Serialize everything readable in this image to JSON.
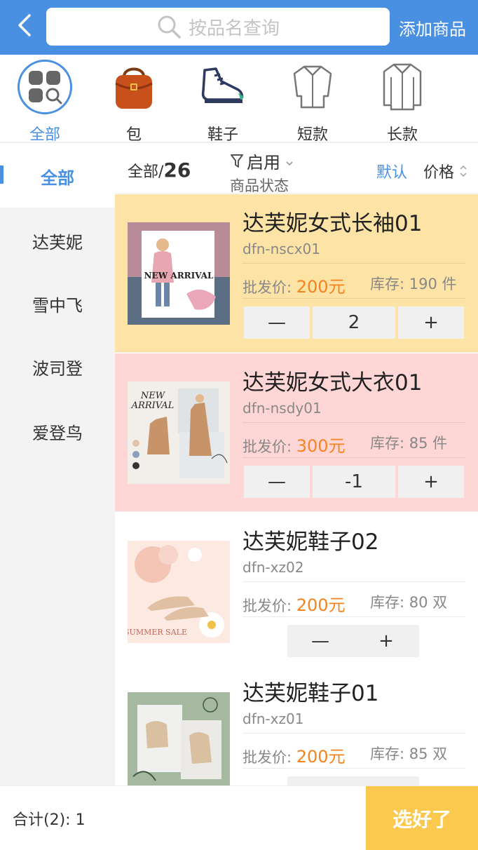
{
  "header": {
    "search_placeholder": "按品名查询",
    "add_label": "添加商品"
  },
  "categories": [
    {
      "label": "全部",
      "icon": "grid-search-icon",
      "active": true
    },
    {
      "label": "包",
      "icon": "bag-icon"
    },
    {
      "label": "鞋子",
      "icon": "shoe-icon"
    },
    {
      "label": "短款",
      "icon": "short-shirt-icon"
    },
    {
      "label": "长款",
      "icon": "long-shirt-icon"
    }
  ],
  "sidebar": {
    "items": [
      {
        "label": "全部",
        "active": true
      },
      {
        "label": "达芙妮"
      },
      {
        "label": "雪中飞"
      },
      {
        "label": "波司登"
      },
      {
        "label": "爱登鸟"
      }
    ]
  },
  "filter": {
    "count_prefix": "全部/",
    "count": "26",
    "status_value": "启用",
    "status_label": "商品状态",
    "sort_default": "默认",
    "sort_price": "价格"
  },
  "products": [
    {
      "name": "达芙妮女式长袖01",
      "code": "dfn-nscx01",
      "price_label": "批发价:",
      "price": "200元",
      "stock": "库存: 190 件",
      "qty": "2",
      "bg": "#fde3a6"
    },
    {
      "name": "达芙妮女式大衣01",
      "code": "dfn-nsdy01",
      "price_label": "批发价:",
      "price": "300元",
      "stock": "库存: 85 件",
      "qty": "-1",
      "bg": "#ffd6d6"
    },
    {
      "name": "达芙妮鞋子02",
      "code": "dfn-xz02",
      "price_label": "批发价:",
      "price": "200元",
      "stock": "库存: 80 双",
      "qty": "",
      "bg": "#ffffff"
    },
    {
      "name": "达芙妮鞋子01",
      "code": "dfn-xz01",
      "price_label": "批发价:",
      "price": "200元",
      "stock": "库存: 85 双",
      "qty": "",
      "bg": "#ffffff"
    }
  ],
  "stepper": {
    "minus": "—",
    "plus": "+"
  },
  "thumb_text": {
    "new_arrival": "NEW ARRIVAL",
    "new": "NEW",
    "arrival": "ARRIVAL",
    "summer_sale": "SUMMER SALE"
  },
  "footer": {
    "total": "合计(2): 1",
    "done_label": "选好了"
  },
  "colors": {
    "primary": "#4a90e2",
    "price": "#f5841f",
    "done": "#fcc94f"
  }
}
